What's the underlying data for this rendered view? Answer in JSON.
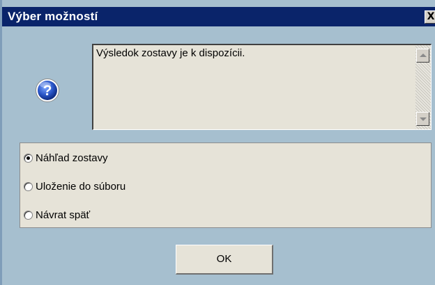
{
  "window": {
    "title": "Výber možností",
    "close_label": "X"
  },
  "icon": {
    "semantic": "question-icon",
    "color": "#2b56c8"
  },
  "message": {
    "text": "Výsledok zostavy je k dispozícii."
  },
  "options": {
    "items": [
      {
        "label": "Náhľad zostavy",
        "selected": true
      },
      {
        "label": "Uloženie do súboru",
        "selected": false
      },
      {
        "label": "Návrat späť",
        "selected": false
      }
    ]
  },
  "actions": {
    "ok_label": "OK"
  },
  "colors": {
    "titlebar": "#0a246a",
    "dialog_bg": "#a6bfcf",
    "panel_bg": "#e6e3d8"
  }
}
